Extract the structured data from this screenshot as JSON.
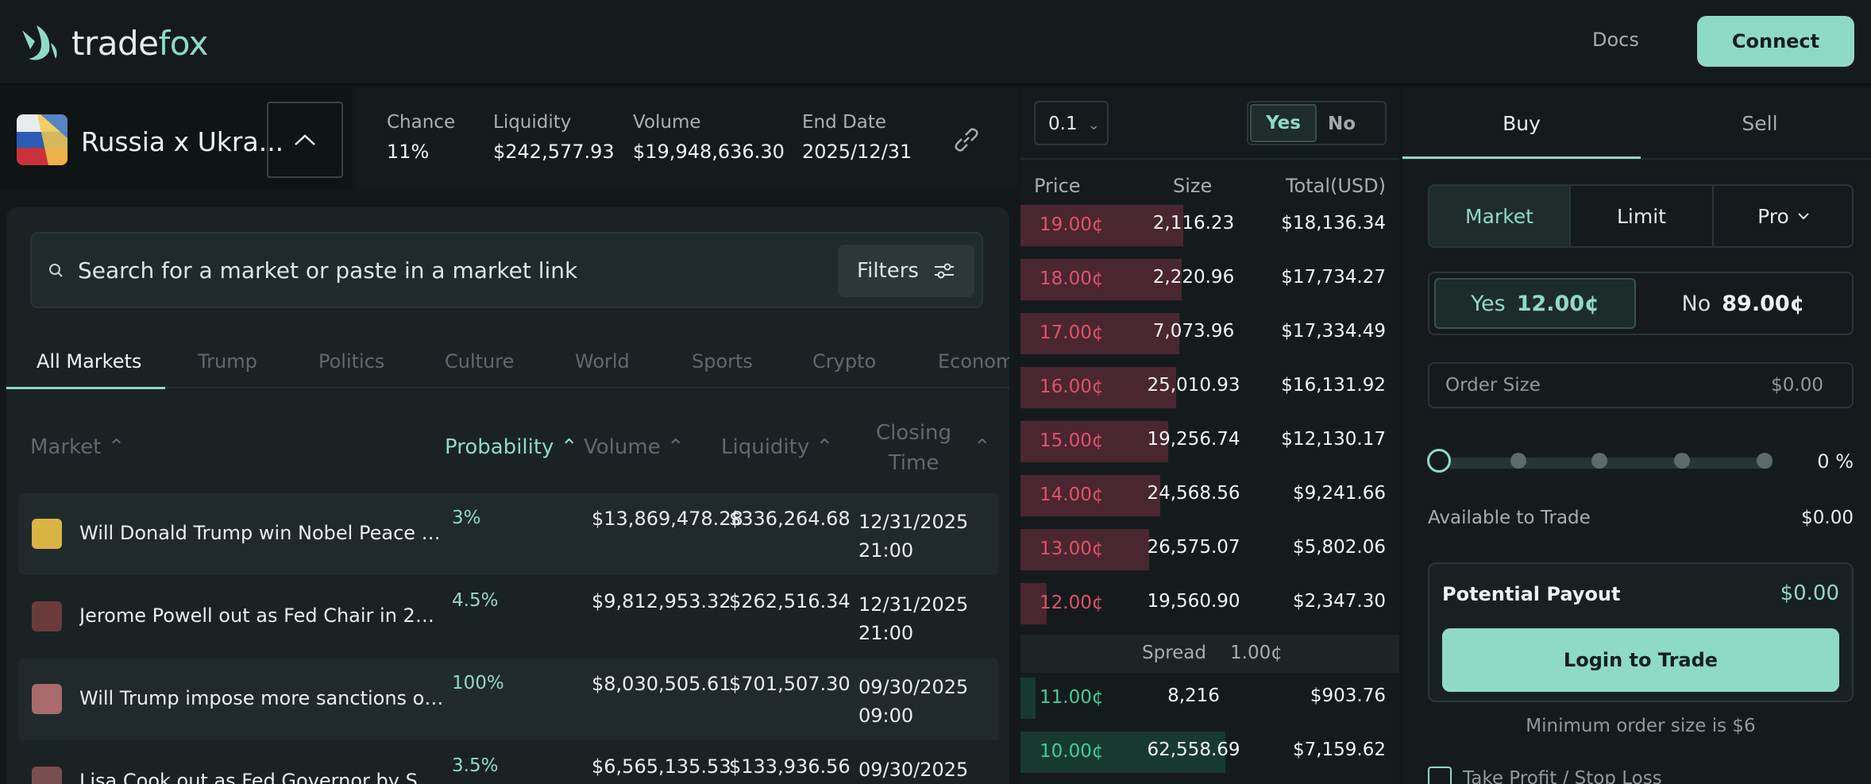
{
  "brand": {
    "name_prefix": "trade",
    "name_suffix": "fox"
  },
  "nav": {
    "docs": "Docs",
    "connect": "Connect"
  },
  "market": {
    "title": "Russia x Ukra...",
    "stats": [
      {
        "label": "Chance",
        "value": "11%"
      },
      {
        "label": "Liquidity",
        "value": "$242,577.93"
      },
      {
        "label": "Volume",
        "value": "$19,948,636.30"
      },
      {
        "label": "End Date",
        "value": "2025/12/31"
      }
    ]
  },
  "search": {
    "placeholder": "Search for a market or paste in a market link",
    "filters": "Filters"
  },
  "tabs": [
    "All Markets",
    "Trump",
    "Politics",
    "Culture",
    "World",
    "Sports",
    "Crypto",
    "Econom"
  ],
  "table": {
    "headers": {
      "market": "Market",
      "probability": "Probability",
      "volume": "Volume",
      "liquidity": "Liquidity",
      "closing_l1": "Closing",
      "closing_l2": "Time"
    },
    "rows": [
      {
        "title": "Will Donald Trump win Nobel Peace Pri...",
        "probability": "3%",
        "volume": "$13,869,478.28",
        "liquidity": "$336,264.68",
        "close_date": "12/31/2025",
        "close_time": "21:00"
      },
      {
        "title": "Jerome Powell out as Fed Chair in 2025?",
        "probability": "4.5%",
        "volume": "$9,812,953.32",
        "liquidity": "$262,516.34",
        "close_date": "12/31/2025",
        "close_time": "21:00"
      },
      {
        "title": "Will Trump impose more sanctions on ...",
        "probability": "100%",
        "volume": "$8,030,505.61",
        "liquidity": "$701,507.30",
        "close_date": "09/30/2025",
        "close_time": "09:00"
      },
      {
        "title": "Lisa Cook out as Fed Governor by Septe...",
        "probability": "3.5%",
        "volume": "$6,565,135.53",
        "liquidity": "$133,936.56",
        "close_date": "09/30/2025",
        "close_time": ""
      }
    ]
  },
  "orderbook": {
    "tick": "0.1",
    "toggle_yes": "Yes",
    "toggle_no": "No",
    "headers": {
      "price": "Price",
      "size": "Size",
      "total": "Total(USD)"
    },
    "asks": [
      {
        "price": "19.00¢",
        "size": "2,116.23",
        "total": "$18,136.34",
        "depth": 0.43
      },
      {
        "price": "18.00¢",
        "size": "2,220.96",
        "total": "$17,734.27",
        "depth": 0.425
      },
      {
        "price": "17.00¢",
        "size": "7,073.96",
        "total": "$17,334.49",
        "depth": 0.42
      },
      {
        "price": "16.00¢",
        "size": "25,010.93",
        "total": "$16,131.92",
        "depth": 0.41
      },
      {
        "price": "15.00¢",
        "size": "19,256.74",
        "total": "$12,130.17",
        "depth": 0.39
      },
      {
        "price": "14.00¢",
        "size": "24,568.56",
        "total": "$9,241.66",
        "depth": 0.37
      },
      {
        "price": "13.00¢",
        "size": "26,575.07",
        "total": "$5,802.06",
        "depth": 0.34
      },
      {
        "price": "12.00¢",
        "size": "19,560.90",
        "total": "$2,347.30",
        "depth": 0.07
      }
    ],
    "spread_label": "Spread",
    "spread_value": "1.00¢",
    "bids": [
      {
        "price": "11.00¢",
        "size": "8,216",
        "total": "$903.76",
        "depth": 0.04
      },
      {
        "price": "10.00¢",
        "size": "62,558.69",
        "total": "$7,159.62",
        "depth": 0.54
      }
    ],
    "ask_color": "#e0526b",
    "bid_color": "#3fcf99"
  },
  "trade": {
    "buy": "Buy",
    "sell": "Sell",
    "order_types": [
      "Market",
      "Limit",
      "Pro"
    ],
    "yes_label": "Yes",
    "yes_price": "12.00¢",
    "no_label": "No",
    "no_price": "89.00¢",
    "order_size_label": "Order Size",
    "order_size_value": "$0.00",
    "slider_pct": "0 %",
    "available_label": "Available to Trade",
    "available_value": "$0.00",
    "payout_label": "Potential Payout",
    "payout_value": "$0.00",
    "login": "Login to Trade",
    "min_order": "Minimum order size is $6",
    "tpsl": "Take Profit / Stop Loss"
  },
  "colors": {
    "accent": "#8fd9c8",
    "background": "#13191b"
  }
}
